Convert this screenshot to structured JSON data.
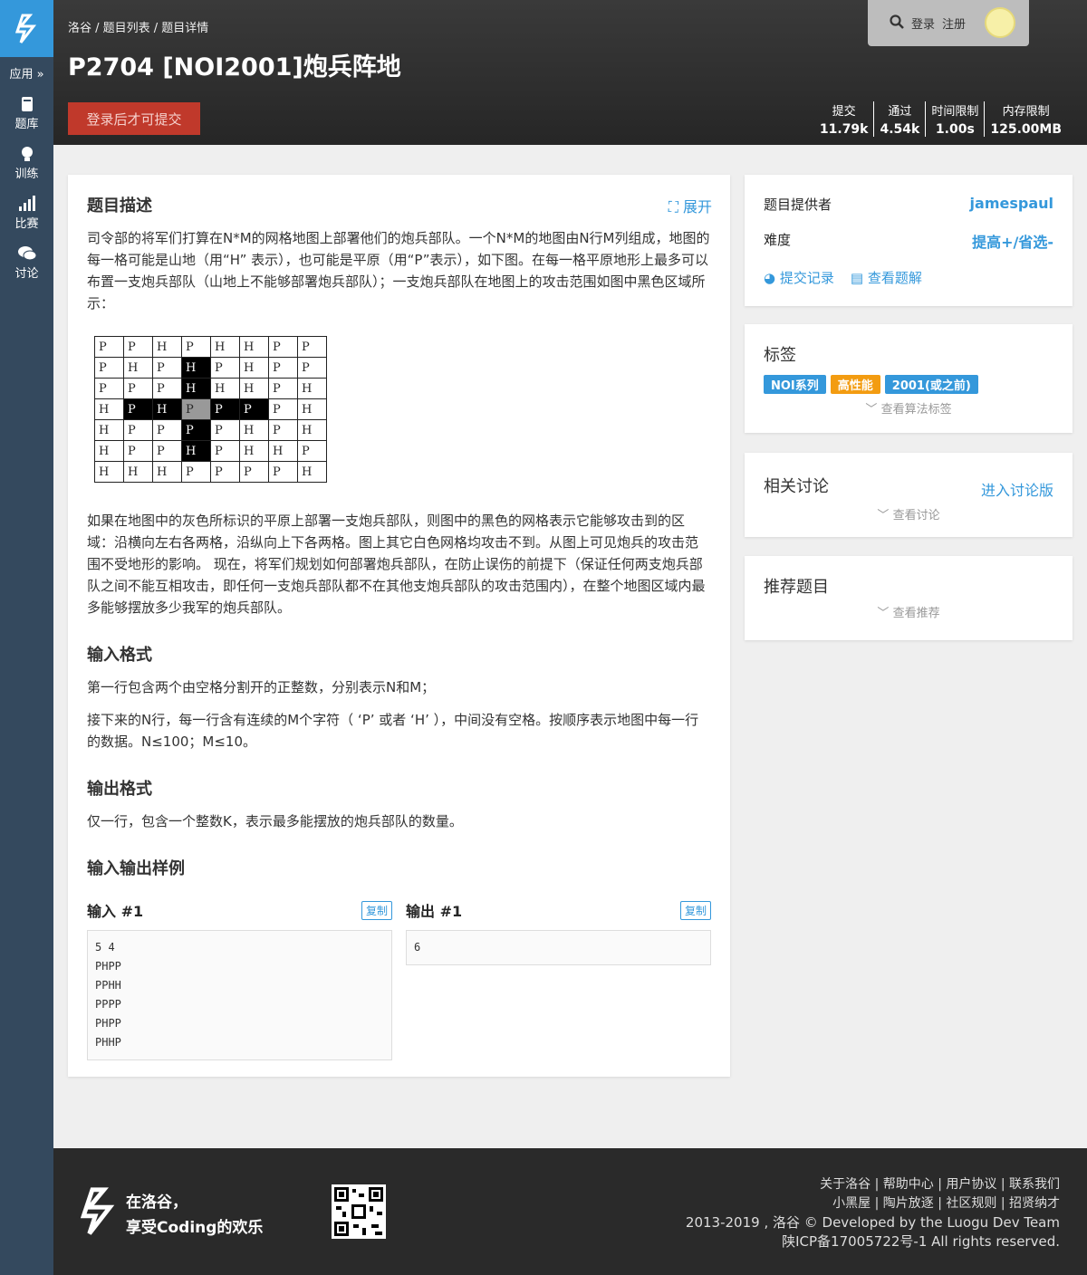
{
  "sidebar": {
    "app_label": "应用 »",
    "items": [
      {
        "label": "题库",
        "icon": "book-icon"
      },
      {
        "label": "训练",
        "icon": "lightbulb-icon"
      },
      {
        "label": "比赛",
        "icon": "bar-chart-icon"
      },
      {
        "label": "讨论",
        "icon": "chat-icon"
      }
    ]
  },
  "header": {
    "breadcrumb": "洛谷 / 题目列表 / 题目详情",
    "title": "P2704 [NOI2001]炮兵阵地",
    "submit_label": "登录后才可提交",
    "login": "登录",
    "register": "注册",
    "stats": [
      {
        "label": "提交",
        "value": "11.79k"
      },
      {
        "label": "通过",
        "value": "4.54k"
      },
      {
        "label": "时间限制",
        "value": "1.00s"
      },
      {
        "label": "内存限制",
        "value": "125.00MB"
      }
    ]
  },
  "problem": {
    "desc_title": "题目描述",
    "expand": "展开",
    "desc_p1": "司令部的将军们打算在N*M的网格地图上部署他们的炮兵部队。一个N*M的地图由N行M列组成，地图的每一格可能是山地（用“H” 表示），也可能是平原（用“P”表示），如下图。在每一格平原地形上最多可以布置一支炮兵部队（山地上不能够部署炮兵部队）；一支炮兵部队在地图上的攻击范围如图中黑色区域所示：",
    "desc_p2": "如果在地图中的灰色所标识的平原上部署一支炮兵部队，则图中的黑色的网格表示它能够攻击到的区域：沿横向左右各两格，沿纵向上下各两格。图上其它白色网格均攻击不到。从图上可见炮兵的攻击范围不受地形的影响。 现在，将军们规划如何部署炮兵部队，在防止误伤的前提下（保证任何两支炮兵部队之间不能互相攻击，即任何一支炮兵部队都不在其他支炮兵部队的攻击范围内），在整个地图区域内最多能够摆放多少我军的炮兵部队。",
    "input_title": "输入格式",
    "input_p1": "第一行包含两个由空格分割开的正整数，分别表示N和M；",
    "input_p2": "接下来的N行，每一行含有连续的M个字符（ ‘P’ 或者 ‘H’ ），中间没有空格。按顺序表示地图中每一行的数据。N≤100；M≤10。",
    "output_title": "输出格式",
    "output_p1": "仅一行，包含一个整数K，表示最多能摆放的炮兵部队的数量。",
    "samples_title": "输入输出样例",
    "sample_in_label": "输入 #1",
    "sample_out_label": "输出 #1",
    "copy_label": "复制",
    "sample_in": "5 4\nPHPP\nPPHH\nPPPP\nPHPP\nPHHP",
    "sample_out": "6"
  },
  "grid": [
    [
      "P",
      "P",
      "H",
      "P",
      "H",
      "H",
      "P",
      "P"
    ],
    [
      "P",
      "H",
      "P",
      "H",
      "P",
      "H",
      "P",
      "P"
    ],
    [
      "P",
      "P",
      "P",
      "H",
      "H",
      "H",
      "P",
      "H"
    ],
    [
      "H",
      "P",
      "H",
      "P",
      "P",
      "P",
      "P",
      "H"
    ],
    [
      "H",
      "P",
      "P",
      "P",
      "P",
      "H",
      "P",
      "H"
    ],
    [
      "H",
      "P",
      "P",
      "H",
      "P",
      "H",
      "H",
      "P"
    ],
    [
      "H",
      "H",
      "H",
      "P",
      "P",
      "P",
      "P",
      "H"
    ]
  ],
  "info": {
    "provider_label": "题目提供者",
    "provider": "jamespaul",
    "difficulty_label": "难度",
    "difficulty": "提高+/省选-",
    "records_link": "提交记录",
    "solutions_link": "查看题解"
  },
  "tags": {
    "title": "标签",
    "items": [
      {
        "label": "NOI系列",
        "color": "#3498db"
      },
      {
        "label": "高性能",
        "color": "#f39c11"
      },
      {
        "label": "2001(或之前)",
        "color": "#3498db"
      }
    ],
    "more": "查看算法标签"
  },
  "discuss": {
    "title": "相关讨论",
    "enter": "进入讨论版",
    "more": "查看讨论"
  },
  "recommend": {
    "title": "推荐题目",
    "more": "查看推荐"
  },
  "footer": {
    "slogan1": "在洛谷，",
    "slogan2": "享受Coding的欢乐",
    "links1": "关于洛谷 | 帮助中心 | 用户协议 | 联系我们",
    "links2": "小黑屋 | 陶片放逐 | 社区规则 | 招贤纳才",
    "copyright": "2013-2019 , 洛谷 © Developed by the Luogu Dev Team",
    "icp": "陕ICP备17005722号-1 All rights reserved."
  }
}
